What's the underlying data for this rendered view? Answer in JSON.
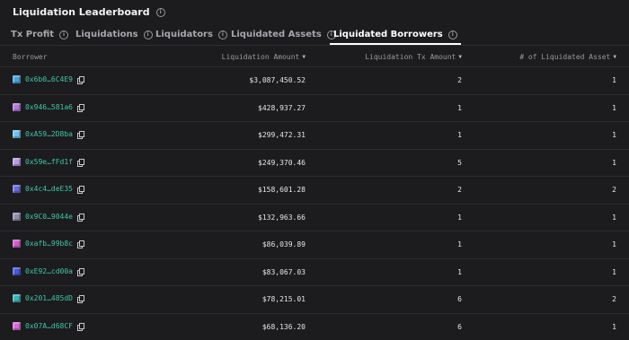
{
  "title": "Liquidation Leaderboard",
  "tabs": [
    {
      "label": "Tx Profit",
      "active": false
    },
    {
      "label": "Liquidations",
      "active": false
    },
    {
      "label": "Liquidators",
      "active": false
    },
    {
      "label": "Liquidated Assets",
      "active": false
    },
    {
      "label": "Liquidated Borrowers",
      "active": true
    }
  ],
  "table": {
    "headers": {
      "borrower": "Borrower",
      "amount": "Liquidation Amount",
      "tx": "Liquidation Tx Amount",
      "assets": "# of Liquidated Asset"
    },
    "rows": [
      {
        "address": "0x6b0…6C4E9",
        "amount": "$3,087,450.52",
        "tx": "2",
        "assets": "1",
        "avatar": "#4aa3d8"
      },
      {
        "address": "0x946…581a6",
        "amount": "$428,937.27",
        "tx": "1",
        "assets": "1",
        "avatar": "#b478d8"
      },
      {
        "address": "0xA59…2D8ba",
        "amount": "$299,472.31",
        "tx": "1",
        "assets": "1",
        "avatar": "#6fc1e6"
      },
      {
        "address": "0x59e…fFd1f",
        "amount": "$249,370.46",
        "tx": "5",
        "assets": "1",
        "avatar": "#b89ae6"
      },
      {
        "address": "0x4c4…deE35",
        "amount": "$158,601.28",
        "tx": "2",
        "assets": "2",
        "avatar": "#6a6ad8"
      },
      {
        "address": "0x9C0…9044e",
        "amount": "$132,963.66",
        "tx": "1",
        "assets": "1",
        "avatar": "#8f8fa8"
      },
      {
        "address": "0xafb…99b8c",
        "amount": "$86,039.89",
        "tx": "1",
        "assets": "1",
        "avatar": "#d05cc8"
      },
      {
        "address": "0xE92…cd00a",
        "amount": "$83,067.03",
        "tx": "1",
        "assets": "1",
        "avatar": "#4b58d8"
      },
      {
        "address": "0x201…485dD",
        "amount": "$78,215.01",
        "tx": "6",
        "assets": "2",
        "avatar": "#3bb0b8"
      },
      {
        "address": "0x07A…d68CF",
        "amount": "$68,136.20",
        "tx": "6",
        "assets": "1",
        "avatar": "#d86bd0"
      }
    ]
  },
  "colors": {
    "accent_address": "#41c6a8",
    "background": "#1c1c1f"
  }
}
